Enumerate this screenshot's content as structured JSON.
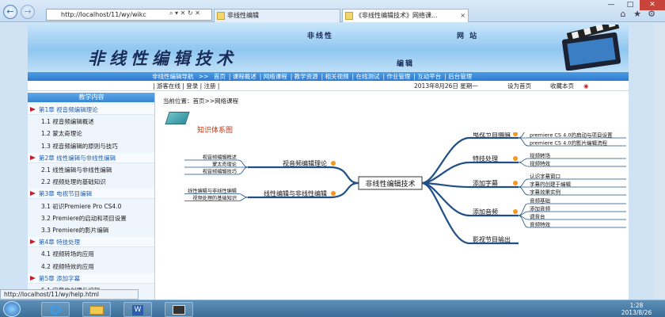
{
  "browser": {
    "address": "http://localhost/11/wy/wikc",
    "tabs": [
      {
        "label": "非线性编辑"
      },
      {
        "label": "《非线性编辑技术》网络课..."
      }
    ],
    "status_url": "http://localhost/11/wy/help.html"
  },
  "site": {
    "title": "非线性编辑技术",
    "banner_small": [
      "非线性",
      "网 站",
      "编辑"
    ],
    "nav": [
      "非线性编辑导航",
      ">>",
      "首页",
      "课程概述",
      "网络课程",
      "教学资源",
      "相关视频",
      "在线测试",
      "作业管理",
      "互动平台",
      "后台管理"
    ],
    "subbar": {
      "left": "| 游客在线 | 登录 | 注册 |",
      "date": "2013年8月26日 星期一",
      "links": [
        "设为首页",
        "收藏本页"
      ]
    }
  },
  "sidebar": {
    "title": "教学内容",
    "items": [
      {
        "type": "chap",
        "label": "第1章 视音频编辑理论"
      },
      {
        "type": "sec",
        "label": "1.1 视音频编辑概述"
      },
      {
        "type": "sec",
        "label": "1.2 蒙太奇理论"
      },
      {
        "type": "sec",
        "label": "1.3 视音频编辑的原则与技巧"
      },
      {
        "type": "chap",
        "label": "第2章 线性编辑与非线性编辑"
      },
      {
        "type": "sec",
        "label": "2.1 线性编辑与非线性编辑"
      },
      {
        "type": "sec",
        "label": "2.2 视频处理的基础知识"
      },
      {
        "type": "chap",
        "label": "第3章 电视节目编辑"
      },
      {
        "type": "sec",
        "label": "3.1 初识Premiere Pro CS4.0"
      },
      {
        "type": "sec",
        "label": "3.2 Premiere的启动和项目设置"
      },
      {
        "type": "sec",
        "label": "3.3 Premiere的影片编辑"
      },
      {
        "type": "chap",
        "label": "第4章 特技处理"
      },
      {
        "type": "sec",
        "label": "4.1 视频转场的应用"
      },
      {
        "type": "sec",
        "label": "4.2 视频特效的应用"
      },
      {
        "type": "chap",
        "label": "第5章 添加字幕"
      },
      {
        "type": "sec",
        "label": "5.1 字幕的创建与编辑"
      }
    ]
  },
  "content": {
    "breadcrumb": "当前位置：首页>>网络课程",
    "knowledge_title": "知识体系图",
    "center": "非线性编辑技术",
    "left_branches": [
      {
        "label": "视音频编辑理论",
        "leaves": [
          "视音频编辑概述",
          "蒙太奇理论",
          "视音频编辑技巧"
        ]
      },
      {
        "label": "线性编辑与非线性编辑",
        "leaves": [
          "线性编辑与非线性编辑",
          "视频处理的基础知识"
        ]
      }
    ],
    "right_branches": [
      {
        "label": "电视节目编辑",
        "leaves": [
          "初识premiere CS 4.0",
          "premiere CS 4.0的启动与项目设置",
          "premiere CS 4.0的影片编辑流程"
        ]
      },
      {
        "label": "特技处理",
        "leaves": [
          "视频转场",
          "视频特效"
        ]
      },
      {
        "label": "添加字幕",
        "leaves": [
          "认识字幕窗口",
          "字幕的创建于编辑",
          "字幕效果实例"
        ]
      },
      {
        "label": "添加音频",
        "leaves": [
          "音频基础",
          "添加音频",
          "调音台",
          "音频特效"
        ]
      },
      {
        "label": "影视节目输出",
        "leaves": []
      }
    ]
  },
  "taskbar": {
    "time": "1:28",
    "date": "2013/8/26"
  },
  "colors": {
    "nav": "#2d7bd0",
    "branch_line": "#1f4f86",
    "chapter_marker": "#c0202a",
    "accent_orange": "#f39a1e"
  }
}
